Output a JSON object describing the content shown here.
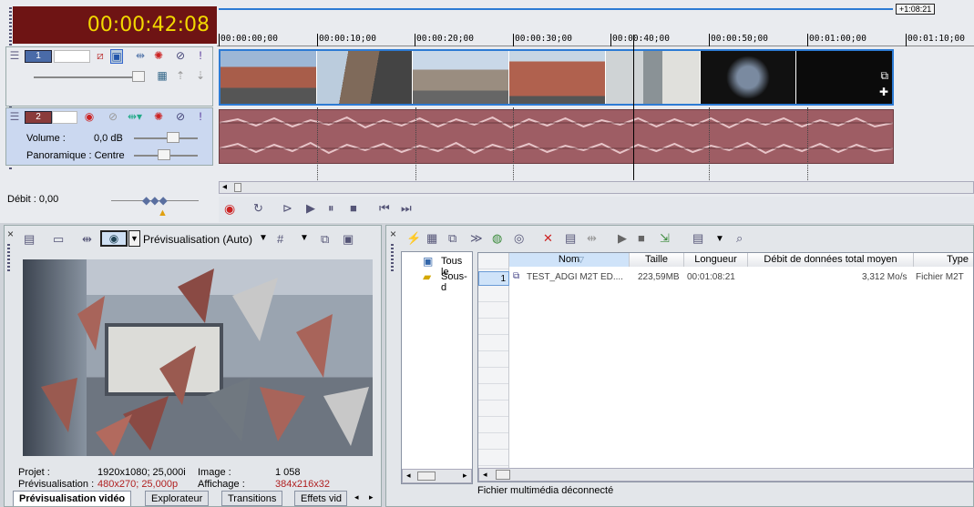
{
  "timeline": {
    "timecode": "00:00:42:08",
    "end_marker": "+1:08:21",
    "ticks": [
      "00:00:00;00",
      "00:00:10;00",
      "00:00:20;00",
      "00:00:30;00",
      "00:00:40;00",
      "00:00:50;00",
      "00:01:00;00",
      "00:01:10;00"
    ],
    "track1": {
      "number": "1"
    },
    "track2": {
      "number": "2",
      "volume_label": "Volume :",
      "volume_value": "0,0 dB",
      "pan_label": "Panoramique : Centre"
    },
    "rate": "Débit : 0,00"
  },
  "preview": {
    "mode": "Prévisualisation (Auto)",
    "info": {
      "project_label": "Projet :",
      "project_value": "1920x1080; 25,000i",
      "preview_label": "Prévisualisation :",
      "preview_value": "480x270; 25,000p",
      "image_label": "Image :",
      "image_value": "1 058",
      "display_label": "Affichage :",
      "display_value": "384x216x32"
    },
    "tabs": [
      "Prévisualisation vidéo",
      "Explorateur",
      "Transitions",
      "Effets vid"
    ]
  },
  "explorer": {
    "tree": [
      "Tous le",
      "Sous-d"
    ],
    "columns": [
      "Nom",
      "Taille",
      "Longueur",
      "Débit de données total moyen",
      "Type"
    ],
    "rows": [
      {
        "index": "1",
        "name": "TEST_ADGI M2T ED....",
        "size": "223,59MB",
        "length": "00:01:08:21",
        "rate": "3,312 Mo/s",
        "type": "Fichier M2T"
      }
    ],
    "status": "Fichier multimédia déconnecté"
  },
  "colors": {
    "timecode_bg": "#6e1414",
    "timecode_fg": "#f2d800",
    "selection": "#2d7bd4",
    "audio": "#9e5d64"
  }
}
